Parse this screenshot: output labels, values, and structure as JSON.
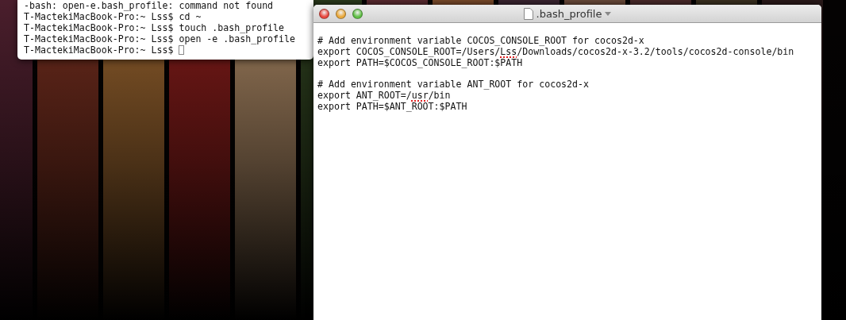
{
  "terminal": {
    "lines": [
      "-bash: open-e.bash_profile: command not found",
      "T-MactekiMacBook-Pro:~ Lss$ cd ~",
      "T-MactekiMacBook-Pro:~ Lss$ touch .bash_profile",
      "T-MactekiMacBook-Pro:~ Lss$ open -e .bash_profile",
      "T-MactekiMacBook-Pro:~ Lss$"
    ]
  },
  "editor": {
    "title": ".bash_profile",
    "paragraphs": [
      [
        [
          {
            "text": "# Add environment variable COCOS_CONSOLE_ROOT for cocos2d-x",
            "misspelled": false
          }
        ],
        [
          {
            "text": "export COCOS_CONSOLE_ROOT=/Users/",
            "misspelled": false
          },
          {
            "text": "Lss",
            "misspelled": true
          },
          {
            "text": "/Downloads/cocos2d-x-3.2/tools/cocos2d-console/bin",
            "misspelled": false
          }
        ],
        [
          {
            "text": "export PATH=$COCOS_CONSOLE_ROOT:$PATH",
            "misspelled": false
          }
        ]
      ],
      [
        [
          {
            "text": "# Add environment variable ANT_ROOT for cocos2d-x",
            "misspelled": false
          }
        ],
        [
          {
            "text": "export ANT_ROOT=/",
            "misspelled": false
          },
          {
            "text": "usr",
            "misspelled": true
          },
          {
            "text": "/bin",
            "misspelled": false
          }
        ],
        [
          {
            "text": "export PATH=$ANT_ROOT:$PATH",
            "misspelled": false
          }
        ]
      ]
    ]
  }
}
